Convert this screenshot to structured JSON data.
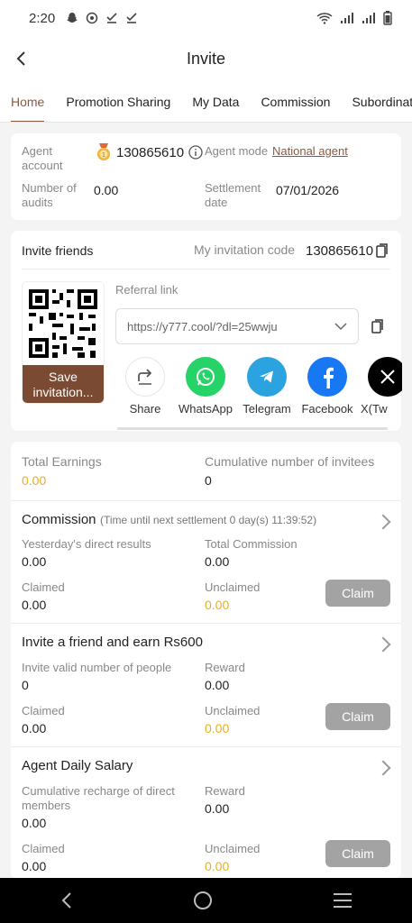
{
  "status_bar": {
    "time": "2:20"
  },
  "header": {
    "title": "Invite"
  },
  "tabs": [
    "Home",
    "Promotion Sharing",
    "My Data",
    "Commission",
    "Subordinate"
  ],
  "agent": {
    "account_label": "Agent account",
    "account_value": "130865610",
    "mode_label": "Agent mode",
    "mode_value": "National agent",
    "audits_label": "Number of audits",
    "audits_value": "0.00",
    "settlement_label": "Settlement date",
    "settlement_value": "07/01/2026"
  },
  "invite": {
    "title": "Invite friends",
    "code_label": "My invitation code",
    "code_value": "130865610",
    "save_label": "Save invitation...",
    "referral_label": "Referral link",
    "referral_value": "https://y777.cool/?dl=25wwju",
    "share_items": [
      "Share",
      "WhatsApp",
      "Telegram",
      "Facebook",
      "X(Tw"
    ]
  },
  "totals": {
    "earnings_label": "Total Earnings",
    "earnings_value": "0.00",
    "invitees_label": "Cumulative number of invitees",
    "invitees_value": "0"
  },
  "commission": {
    "title": "Commission",
    "subtitle": "(Time until next settlement 0 day(s) 11:39:52)",
    "yesterday_label": "Yesterday's direct results",
    "yesterday_value": "0.00",
    "total_label": "Total Commission",
    "total_value": "0.00",
    "claimed_label": "Claimed",
    "claimed_value": "0.00",
    "unclaimed_label": "Unclaimed",
    "unclaimed_value": "0.00",
    "claim_button": "Claim"
  },
  "invite_reward": {
    "title": "Invite a friend and earn Rs600",
    "valid_label": "Invite valid number of people",
    "valid_value": "0",
    "reward_label": "Reward",
    "reward_value": "0.00",
    "claimed_label": "Claimed",
    "claimed_value": "0.00",
    "unclaimed_label": "Unclaimed",
    "unclaimed_value": "0.00",
    "claim_button": "Claim"
  },
  "salary": {
    "title": "Agent Daily Salary",
    "recharge_label": "Cumulative recharge of direct members",
    "recharge_value": "0.00",
    "reward_label": "Reward",
    "reward_value": "0.00",
    "claimed_label": "Claimed",
    "claimed_value": "0.00",
    "unclaimed_label": "Unclaimed",
    "unclaimed_value": "0.00",
    "claim_button": "Claim"
  },
  "colors": {
    "accent": "#8a5a3f",
    "gold": "#e8b020",
    "claim_bg": "#a3a3a3"
  }
}
